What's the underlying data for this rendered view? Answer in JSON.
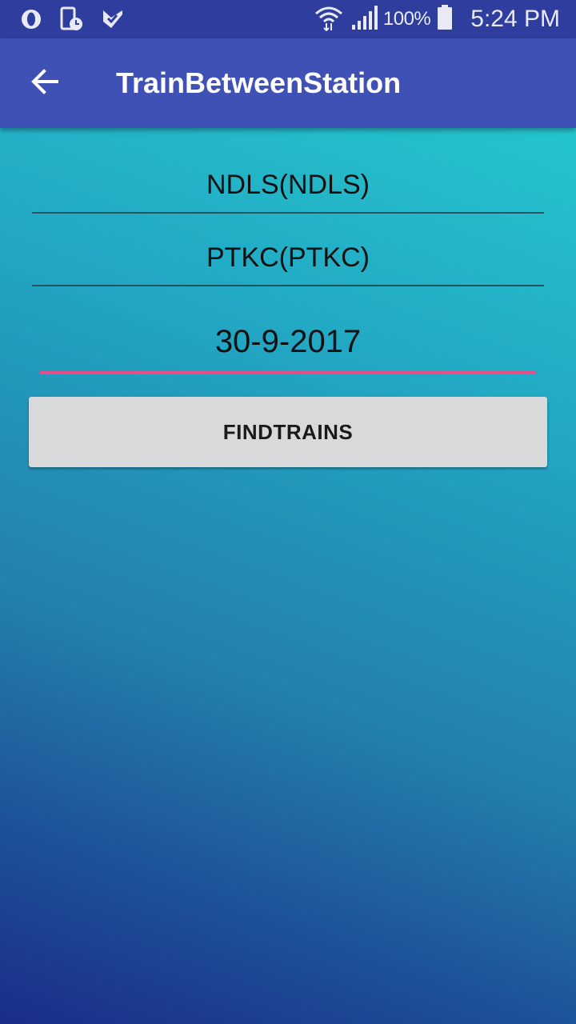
{
  "status_bar": {
    "battery_percent": "100%",
    "time": "5:24 PM",
    "icons": [
      "opera-icon",
      "phone-clock-icon",
      "check-icon",
      "wifi-icon",
      "signal-icon",
      "battery-icon"
    ]
  },
  "app_bar": {
    "title": "TrainBetweenStation",
    "back_icon": "arrow-back-icon"
  },
  "form": {
    "from_station": "NDLS(NDLS)",
    "to_station": "PTKC(PTKC)",
    "date": "30-9-2017",
    "find_button_label": "FINDTRAINS"
  },
  "colors": {
    "app_bar": "#3f51b5",
    "status_bar": "#2f3e9e",
    "accent_underline": "#e84d8a",
    "button_bg": "#d8d9da"
  }
}
